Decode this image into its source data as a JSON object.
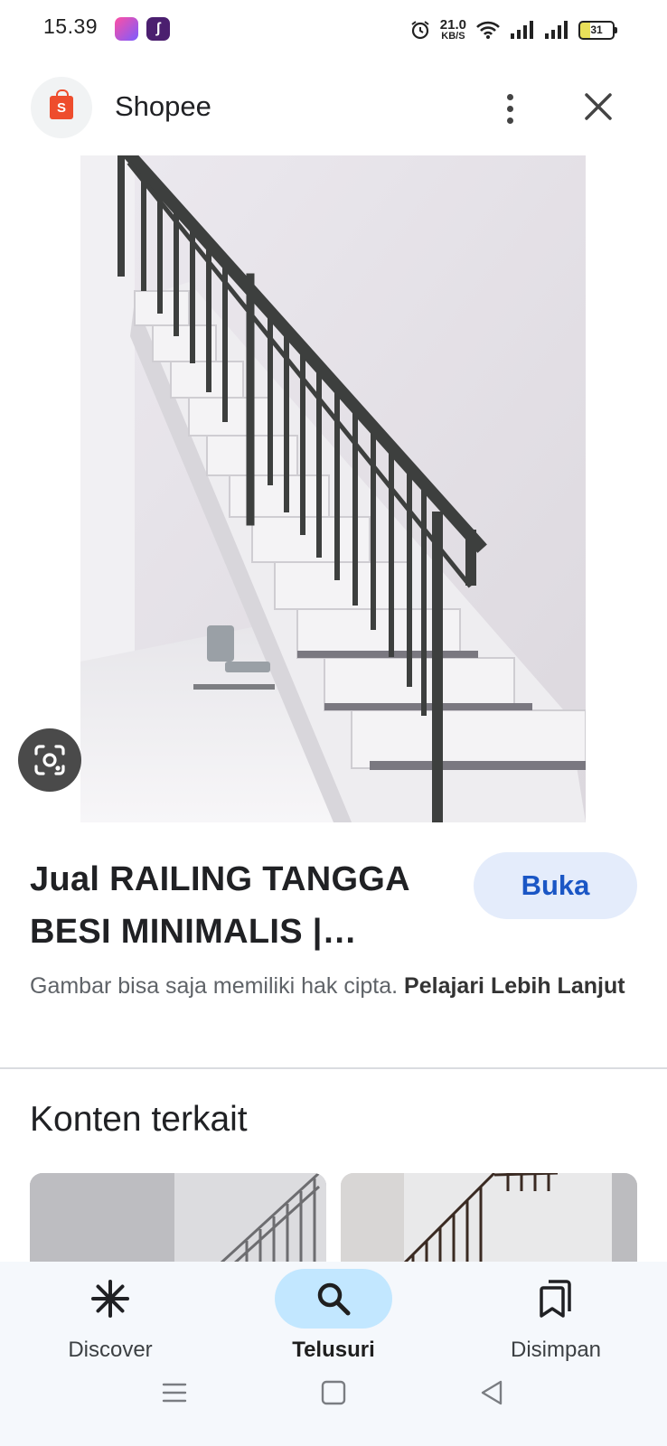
{
  "status_bar": {
    "time": "15.39",
    "app_badge": "ʃ",
    "net_speed_value": "21.0",
    "net_speed_unit": "KB/S",
    "battery": "31"
  },
  "header": {
    "title": "Shopee",
    "app_icon_glyph": "S"
  },
  "result": {
    "title": "Jual RAILING TANGGA BESI MINIMALIS |…",
    "open_button": "Buka",
    "copyright_text": "Gambar bisa saja memiliki hak cipta.",
    "learn_more": "Pelajari Lebih Lanjut"
  },
  "related": {
    "heading": "Konten terkait"
  },
  "bottom_nav": {
    "items": [
      {
        "label": "Discover",
        "icon": "discover-asterisk-icon"
      },
      {
        "label": "Telusuri",
        "icon": "search-icon",
        "active": true
      },
      {
        "label": "Disimpan",
        "icon": "saved-bookmarks-icon"
      }
    ]
  },
  "colors": {
    "accent": "#1a56c5",
    "active_pill": "#c2e7ff",
    "shopee": "#ee4d2d"
  }
}
